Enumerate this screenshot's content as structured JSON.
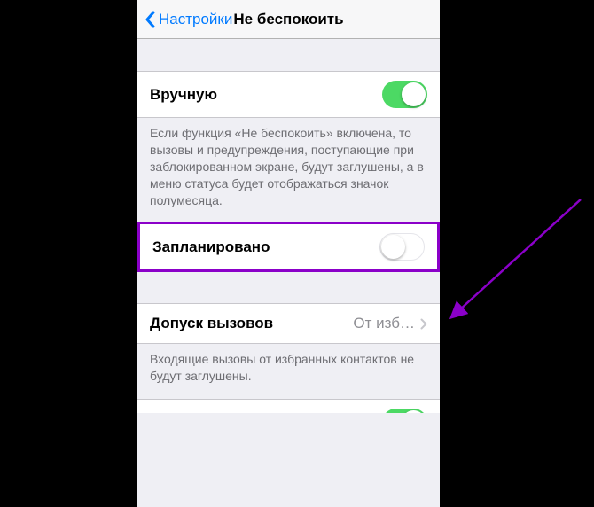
{
  "nav": {
    "back_label": "Настройки",
    "title": "Не беспокоить"
  },
  "rows": {
    "manual": {
      "label": "Вручную",
      "on": true
    },
    "scheduled": {
      "label": "Запланировано",
      "on": false
    },
    "allow_calls": {
      "label": "Допуск вызовов",
      "value": "От изб…"
    }
  },
  "footers": {
    "manual": "Если функция «Не беспокоить» включена, то вызовы и предупреждения, поступающие при заблокированном экране, будут заглушены, а в меню статуса будет отображаться значок полумесяца.",
    "allow_calls": "Входящие вызовы от избранных контактов не будут заглушены."
  },
  "colors": {
    "accent": "#007aff",
    "toggle_on": "#4cd964",
    "highlight": "#8b00c9"
  }
}
